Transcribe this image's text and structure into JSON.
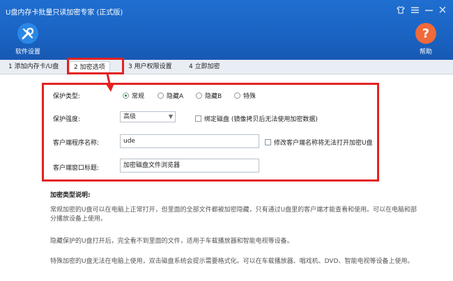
{
  "window": {
    "title": "U盘内存卡批量只读加密专家 (正式版)",
    "controls": [
      "shirt-icon",
      "menu-icon",
      "minimize-icon",
      "close-icon"
    ]
  },
  "toolbar": {
    "settings_label": "软件设置",
    "help_label": "帮助"
  },
  "tabs": [
    {
      "label": "1 添加内存卡/U盘",
      "active": false
    },
    {
      "label": "2 加密选项",
      "active": true
    },
    {
      "label": "3 用户权限设置",
      "active": false
    },
    {
      "label": "4 立即加密",
      "active": false
    }
  ],
  "form": {
    "protect_type_label": "保护类型:",
    "protect_types": [
      "常规",
      "隐藏A",
      "隐藏B",
      "特殊"
    ],
    "protect_type_selected": "常规",
    "protect_level_label": "保护强度:",
    "protect_level_value": "高级",
    "bind_disk_label": "绑定磁盘 (镜像拷贝后无法使用加密数据)",
    "client_name_label": "客户端程序名称:",
    "client_name_value": "ude",
    "modify_name_label": "修改客户端名称将无法打开加密U盘",
    "client_window_label": "客户端窗口标题:",
    "client_window_value": "加密磁盘文件浏览器"
  },
  "description": {
    "title": "加密类型说明:",
    "paragraphs": [
      "常规加密的U盘可以在电脑上正常打开，但里面的全部文件都被加密隐藏，只有通过U盘里的客户端才能查看和使用。可以在电脑和部分播放设备上使用。",
      "隐藏保护的U盘打开后，完全看不到里面的文件，适用于车载播放器和智能电视等设备。",
      "特殊加密的U盘无法在电脑上使用，双击磁盘系统会提示需要格式化。可以在车载播放器、唱戏机、DVD、智能电视等设备上使用。"
    ]
  },
  "colors": {
    "titlebar": "#1a63c2",
    "highlight": "#e32222",
    "help_button": "#f06a3a"
  }
}
